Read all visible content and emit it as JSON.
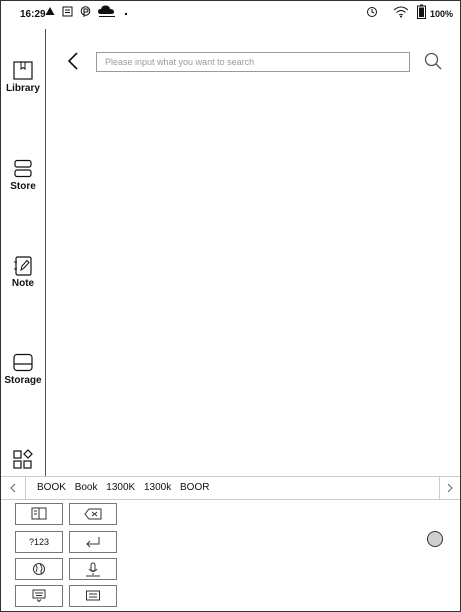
{
  "status_bar": {
    "time": "16:29",
    "battery": "100%",
    "icons": [
      "alert-icon",
      "message-icon",
      "p-icon",
      "cloud-upload-icon",
      "dot-icon",
      "sync-icon",
      "wifi-icon",
      "battery-icon"
    ]
  },
  "sidebar": {
    "items": [
      {
        "label": "Library",
        "icon": "book-icon"
      },
      {
        "label": "Store",
        "icon": "store-icon"
      },
      {
        "label": "Note",
        "icon": "note-icon"
      },
      {
        "label": "Storage",
        "icon": "storage-icon"
      },
      {
        "label": "",
        "icon": "apps-icon"
      }
    ]
  },
  "search": {
    "placeholder": "Please input what you want to search",
    "value": ""
  },
  "keyboard": {
    "suggestions": [
      "BOOK",
      "Book",
      "1300K",
      "1300k",
      "BOOR"
    ],
    "keys": {
      "layout": "",
      "backspace": "",
      "numbers": "?123",
      "enter": "",
      "globe": "",
      "voice": "",
      "hide": "",
      "keyboard": ""
    }
  },
  "colors": {
    "background": "#ffffff",
    "border": "#333333",
    "placeholder": "#9a9a9a"
  }
}
